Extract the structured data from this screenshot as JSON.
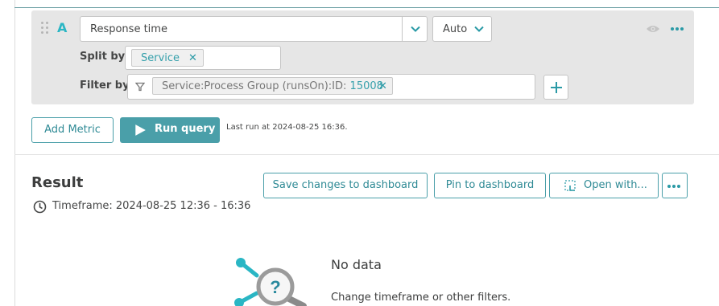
{
  "query": {
    "row_letter": "A",
    "metric_value": "Response time",
    "aggregation_value": "Auto",
    "split_by_label": "Split by",
    "split_by_chips": [
      "Service"
    ],
    "filter_by_label": "Filter by",
    "filter_chip_prefix": "Service:Process Group (runsOn):ID:",
    "filter_chip_value": "15008"
  },
  "actions": {
    "add_metric": "Add Metric",
    "run_query": "Run query",
    "last_run": "Last run at 2024-08-25 16:36."
  },
  "result": {
    "title": "Result",
    "timeframe": "Timeframe: 2024-08-25 12:36 - 16:36",
    "save_changes": "Save changes to dashboard",
    "pin": "Pin to dashboard",
    "open_with": "Open with...",
    "no_data_title": "No data",
    "no_data_subtitle": "Change timeframe or other filters."
  },
  "icons": {
    "drag": "drag-handle-icon",
    "chevron": "chevron-down-icon",
    "remove": "close-icon",
    "filter": "filter-icon",
    "add": "plus-icon",
    "visibility": "eye-icon",
    "more": "more-horizontal-icon",
    "play": "play-icon",
    "clock": "clock-icon",
    "open_with": "open-with-icon",
    "no_data": "no-data-illustration"
  },
  "colors": {
    "accent": "#4a9fa9",
    "chip_text": "#36a0ab",
    "panel_bg": "#e6e6e6"
  }
}
